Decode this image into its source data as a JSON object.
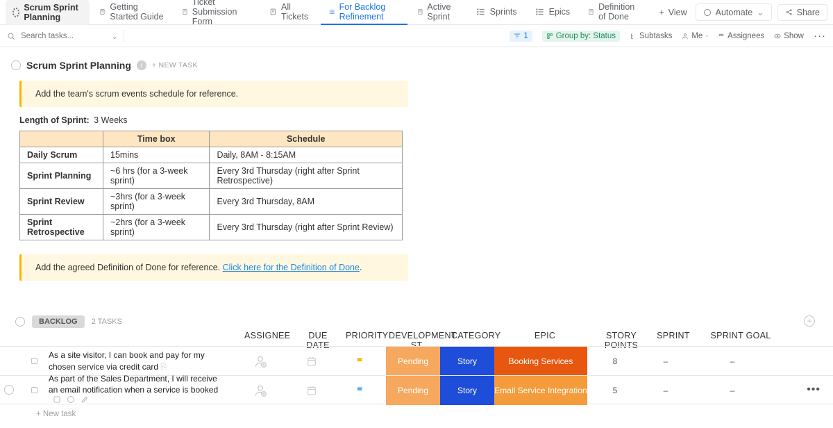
{
  "header": {
    "workspace": "Scrum Sprint Planning",
    "tabs": [
      {
        "icon": "doc",
        "label": "Getting Started Guide",
        "active": false
      },
      {
        "icon": "doc",
        "label": "Ticket Submission Form",
        "active": false
      },
      {
        "icon": "doc",
        "label": "All Tickets",
        "active": false
      },
      {
        "icon": "list",
        "label": "For Backlog Refinement",
        "active": true
      },
      {
        "icon": "doc",
        "label": "Active Sprint",
        "active": false
      },
      {
        "icon": "list",
        "label": "Sprints",
        "active": false
      },
      {
        "icon": "list",
        "label": "Epics",
        "active": false
      },
      {
        "icon": "doc",
        "label": "Definition of Done",
        "active": false
      }
    ],
    "add_view": "View",
    "automate": "Automate",
    "share": "Share"
  },
  "toolbar": {
    "search_placeholder": "Search tasks...",
    "filter_count": "1",
    "group_by": "Group by: Status",
    "subtasks": "Subtasks",
    "me": "Me",
    "assignees": "Assignees",
    "show": "Show"
  },
  "page": {
    "title": "Scrum Sprint Planning",
    "new_task": "+ NEW TASK",
    "banner1": "Add the team's scrum events schedule for reference.",
    "sprint_length_label": "Length of Sprint:",
    "sprint_length_value": "3 Weeks",
    "table_headers": {
      "col2": "Time box",
      "col3": "Schedule"
    },
    "events": [
      {
        "name": "Daily Scrum",
        "timebox": "15mins",
        "schedule": "Daily, 8AM - 8:15AM"
      },
      {
        "name": "Sprint Planning",
        "timebox": "~6 hrs (for a 3-week sprint)",
        "schedule": "Every 3rd Thursday (right after Sprint Retrospective)"
      },
      {
        "name": "Sprint Review",
        "timebox": "~3hrs (for a 3-week sprint)",
        "schedule": "Every 3rd Thursday, 8AM"
      },
      {
        "name": "Sprint Retrospective",
        "timebox": "~2hrs (for a 3-week sprint)",
        "schedule": "Every 3rd Thursday (right after Sprint Review)"
      }
    ],
    "banner2_text": "Add the agreed Definition of Done for reference. ",
    "banner2_link": "Click here for the Definition of Done"
  },
  "list": {
    "group_name": "BACKLOG",
    "task_count": "2 TASKS",
    "add_task": "+ New task",
    "columns": {
      "assignee": "ASSIGNEE",
      "due": "DUE DATE",
      "priority": "PRIORITY",
      "dev": "DEVELOPMENT ST...",
      "category": "CATEGORY",
      "epic": "EPIC",
      "points": "STORY POINTS",
      "sprint": "SPRINT",
      "goal": "SPRINT GOAL"
    },
    "rows": [
      {
        "title": "As a site visitor, I can book and pay for my chosen service via credit card",
        "flag_color": "#f7b500",
        "dev": "Pending",
        "category": "Story",
        "epic": "Booking Services",
        "epic_color": "#e8570f",
        "points": "8",
        "sprint": "–",
        "goal": "–",
        "show_hover": false,
        "show_ellipsis": false
      },
      {
        "title": "As part of the Sales Department, I will receive an email notification when a service is booked",
        "flag_color": "#5aa9ff",
        "dev": "Pending",
        "category": "Story",
        "epic": "Email Service Integration",
        "epic_color": "#f49b3b",
        "points": "5",
        "sprint": "–",
        "goal": "–",
        "show_hover": true,
        "show_ellipsis": true
      }
    ]
  }
}
